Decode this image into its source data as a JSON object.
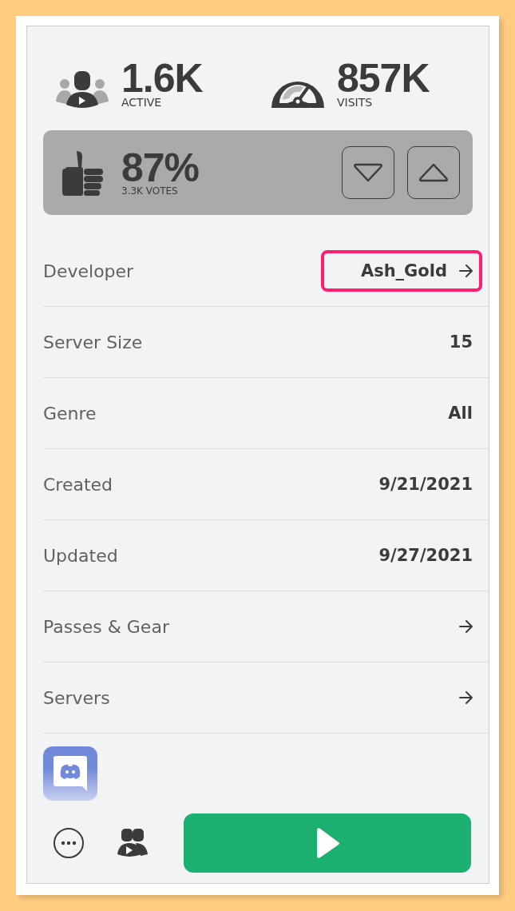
{
  "stats": [
    {
      "kind": "active",
      "value": "1.6K",
      "label": "ACTIVE"
    },
    {
      "kind": "visits",
      "value": "857K",
      "label": "VISITS"
    }
  ],
  "rating": {
    "percent": "87%",
    "votes": "3.3K VOTES"
  },
  "details": [
    {
      "label": "Developer",
      "value": "Ash_Gold",
      "kind": "link",
      "highlighted": true
    },
    {
      "label": "Server Size",
      "value": "15",
      "kind": "value",
      "highlighted": false
    },
    {
      "label": "Genre",
      "value": "All",
      "kind": "value",
      "highlighted": false
    },
    {
      "label": "Created",
      "value": "9/21/2021",
      "kind": "value",
      "highlighted": false
    },
    {
      "label": "Updated",
      "value": "9/27/2021",
      "kind": "value",
      "highlighted": false
    },
    {
      "label": "Passes & Gear",
      "kind": "link",
      "highlighted": false
    },
    {
      "label": "Servers",
      "kind": "link",
      "highlighted": false
    }
  ]
}
